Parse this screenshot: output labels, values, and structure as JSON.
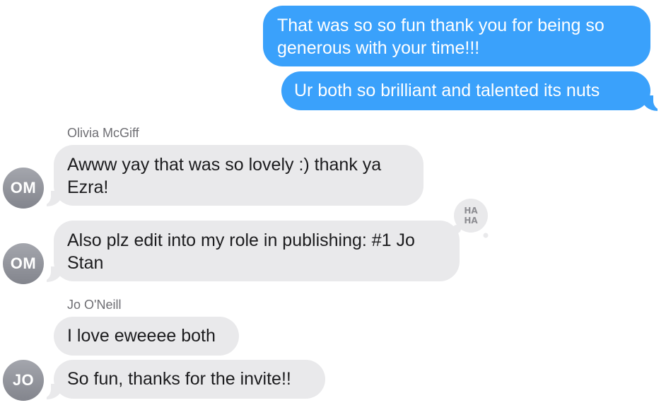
{
  "messages": {
    "sent_1": "That was so so fun thank you for being so generous with your time!!!",
    "sent_2": "Ur both so brilliant and talented its nuts",
    "olivia_name": "Olivia McGiff",
    "olivia_1": "Awww yay that was so lovely :) thank ya Ezra!",
    "olivia_2": "Also plz edit into my role in publishing: #1 Jo Stan",
    "jo_name": "Jo O'Neill",
    "jo_1": "I love eweeee both",
    "jo_2": "So fun, thanks for the invite!!"
  },
  "avatars": {
    "olivia_initials": "OM",
    "jo_initials": "JO"
  },
  "tapback": {
    "icon": "haha-icon",
    "line1": "HA",
    "line2": "HA"
  },
  "colors": {
    "sent_bubble": "#3aa1fb",
    "received_bubble": "#e9e9eb",
    "avatar": "#93959c"
  }
}
